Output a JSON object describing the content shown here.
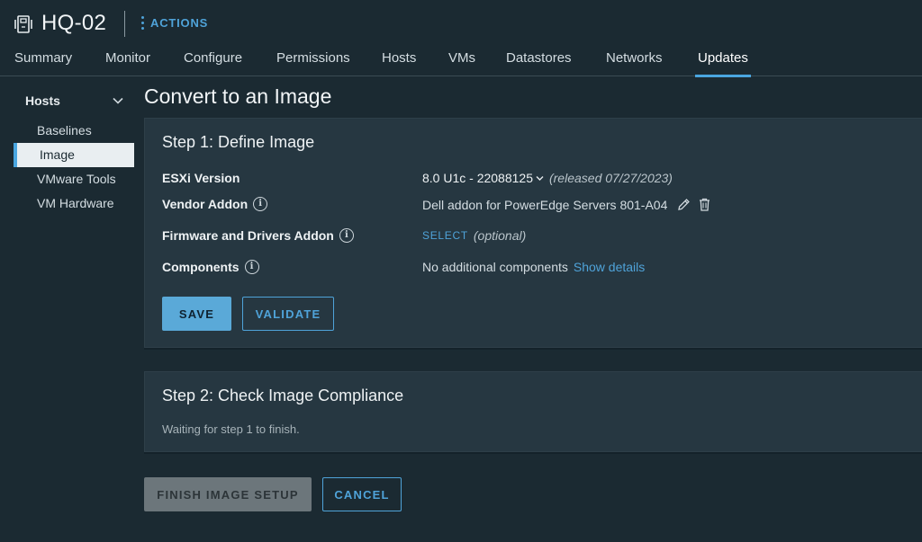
{
  "header": {
    "title": "HQ-02",
    "host_icon": "host-icon",
    "actions_label": "ACTIONS"
  },
  "tabs": [
    {
      "label": "Summary"
    },
    {
      "label": "Monitor"
    },
    {
      "label": "Configure"
    },
    {
      "label": "Permissions"
    },
    {
      "label": "Hosts"
    },
    {
      "label": "VMs"
    },
    {
      "label": "Datastores"
    },
    {
      "label": "Networks"
    },
    {
      "label": "Updates",
      "active": true
    }
  ],
  "sidebar": {
    "heading": "Hosts",
    "items": [
      {
        "label": "Baselines"
      },
      {
        "label": "Image",
        "active": true
      },
      {
        "label": "VMware Tools"
      },
      {
        "label": "VM Hardware"
      }
    ]
  },
  "page": {
    "title": "Convert to an Image"
  },
  "step1": {
    "title": "Step 1: Define Image",
    "esxi_label": "ESXi Version",
    "esxi_value": "8.0 U1c - 22088125",
    "esxi_released": "(released 07/27/2023)",
    "vendor_label": "Vendor Addon",
    "vendor_value": "Dell addon for PowerEdge Servers 801-A04",
    "firmware_label": "Firmware and Drivers Addon",
    "firmware_select": "SELECT",
    "firmware_optional": "(optional)",
    "components_label": "Components",
    "components_value": "No additional components",
    "components_link": "Show details",
    "save_label": "SAVE",
    "validate_label": "VALIDATE"
  },
  "step2": {
    "title": "Step 2: Check Image Compliance",
    "waiting": "Waiting for step 1 to finish."
  },
  "footer": {
    "finish_label": "FINISH IMAGE SETUP",
    "cancel_label": "CANCEL"
  },
  "colors": {
    "background": "#1b2a32",
    "card": "#263741",
    "accent": "#4fa3d9",
    "primary_button": "#5aa9d8",
    "disabled_button": "#6c767b"
  }
}
